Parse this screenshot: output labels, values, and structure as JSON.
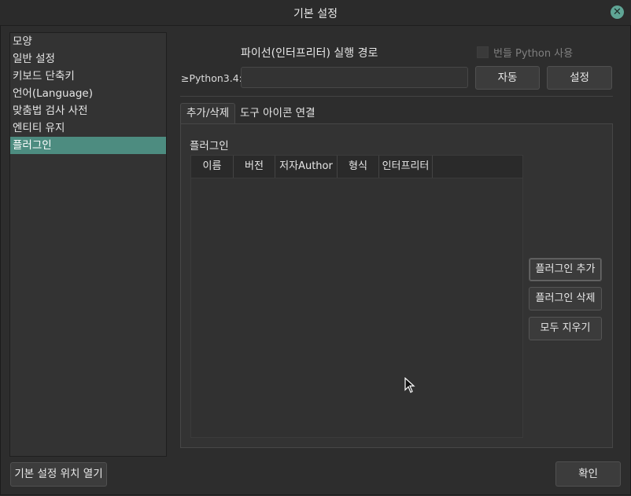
{
  "window": {
    "title": "기본 설정"
  },
  "sidebar": {
    "items": [
      {
        "label": "모양"
      },
      {
        "label": "일반 설정"
      },
      {
        "label": "키보드 단축키"
      },
      {
        "label": "언어(Language)"
      },
      {
        "label": "맞춤법 검사 사전"
      },
      {
        "label": "엔티티 유지"
      },
      {
        "label": "플러그인"
      }
    ],
    "selected": "플러그인"
  },
  "python": {
    "label": "파이선(인터프리터) 실행 경로",
    "bundle_label": "번들 Python 사용",
    "bundle_checked": false,
    "path_label": "≥Python3.4:",
    "path_value": "",
    "auto_button": "자동",
    "settings_button": "설정"
  },
  "tabs": [
    {
      "label": "추가/삭제",
      "active": true
    },
    {
      "label": "도구 아이콘 연결",
      "active": false
    }
  ],
  "plugins": {
    "title": "플러그인",
    "columns": [
      "이름",
      "버전",
      "저자Author",
      "형식",
      "인터프리터"
    ],
    "rows": [],
    "add_button": "플러그인 추가",
    "remove_button": "플러그인 삭제",
    "clear_button": "모두 지우기"
  },
  "footer": {
    "open_location_button": "기본 설정 위치 열기",
    "ok_button": "확인"
  },
  "colors": {
    "accent": "#4d8c80",
    "close": "#5fa595",
    "background": "#2d2d2d"
  }
}
